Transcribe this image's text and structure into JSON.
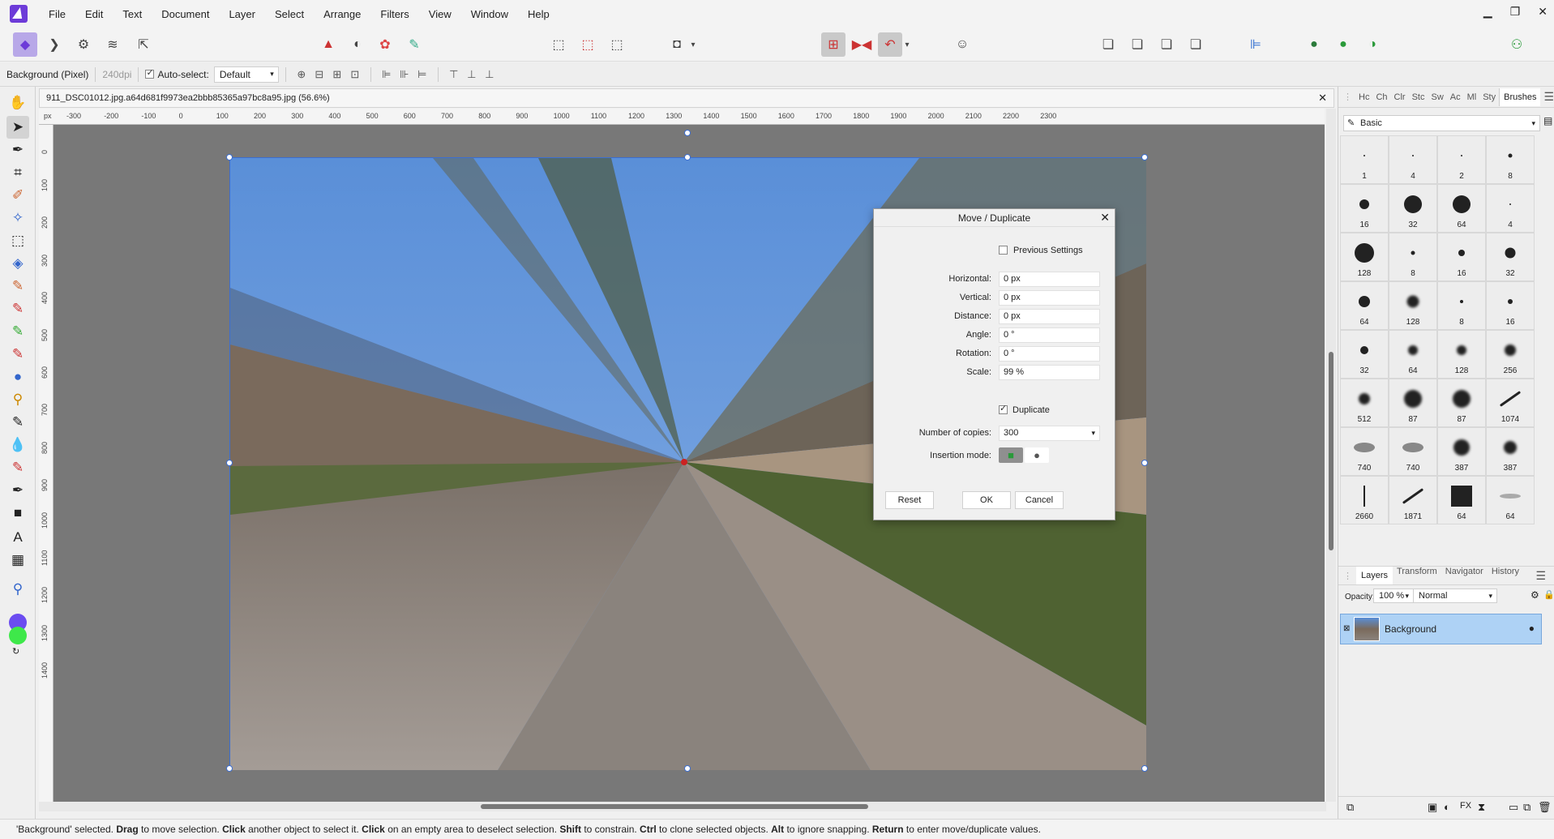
{
  "menu": [
    "File",
    "Edit",
    "Text",
    "Document",
    "Layer",
    "Select",
    "Arrange",
    "Filters",
    "View",
    "Window",
    "Help"
  ],
  "context": {
    "layer_name": "Background (Pixel)",
    "dpi": "240dpi",
    "auto_select_label": "Auto-select:",
    "auto_select_value": "Default"
  },
  "document": {
    "tab_title": "911_DSC01012.jpg.a64d681f9973ea2bbb85365a97bc8a95.jpg (56.6%)",
    "ruler_unit": "px",
    "hruler_ticks": [
      "-300",
      "-200",
      "-100",
      "0",
      "100",
      "200",
      "300",
      "400",
      "500",
      "600",
      "700",
      "800",
      "900",
      "1000",
      "1100",
      "1200",
      "1300",
      "1400",
      "1500",
      "1600",
      "1700",
      "1800",
      "1900",
      "2000",
      "2100",
      "2200",
      "2300"
    ],
    "vruler_ticks": [
      "0",
      "100",
      "200",
      "300",
      "400",
      "500",
      "600",
      "700",
      "800",
      "900",
      "1000",
      "1100",
      "1200",
      "1300",
      "1400"
    ]
  },
  "dialog": {
    "title": "Move / Duplicate",
    "previous_settings": "Previous Settings",
    "fields": [
      {
        "label": "Horizontal:",
        "value": "0 px"
      },
      {
        "label": "Vertical:",
        "value": "0 px"
      },
      {
        "label": "Distance:",
        "value": "0 px"
      },
      {
        "label": "Angle:",
        "value": "0 °"
      },
      {
        "label": "Rotation:",
        "value": "0 °"
      },
      {
        "label": "Scale:",
        "value": "99 %"
      }
    ],
    "duplicate_label": "Duplicate",
    "duplicate_checked": true,
    "copies_label": "Number of copies:",
    "copies_value": "300",
    "insertion_label": "Insertion mode:",
    "reset": "Reset",
    "ok": "OK",
    "cancel": "Cancel"
  },
  "brushes": {
    "tabs": [
      "Hc",
      "Ch",
      "Clr",
      "Stc",
      "Sw",
      "Ac",
      "Ml",
      "Sty"
    ],
    "active_tab": "Brushes",
    "category": "Basic",
    "items": [
      "1",
      "4",
      "2",
      "8",
      "16",
      "32",
      "64",
      "4",
      "128",
      "8",
      "16",
      "32",
      "64",
      "128",
      "8",
      "16",
      "32",
      "64",
      "128",
      "256",
      "512",
      "87",
      "87",
      "1074",
      "740",
      "740",
      "387",
      "387",
      "2660",
      "1871",
      "64",
      "64"
    ]
  },
  "layers": {
    "tabs": [
      "Layers",
      "Transform",
      "Navigator",
      "History"
    ],
    "opacity_label": "Opacity:",
    "opacity_value": "100 %",
    "blend_mode": "Normal",
    "layer_name": "Background"
  },
  "status": {
    "parts": [
      {
        "t": "'Background' selected. ",
        "b": false
      },
      {
        "t": "Drag",
        "b": true
      },
      {
        "t": " to move selection. ",
        "b": false
      },
      {
        "t": "Click",
        "b": true
      },
      {
        "t": " another object to select it. ",
        "b": false
      },
      {
        "t": "Click",
        "b": true
      },
      {
        "t": " on an empty area to deselect selection. ",
        "b": false
      },
      {
        "t": "Shift",
        "b": true
      },
      {
        "t": " to constrain. ",
        "b": false
      },
      {
        "t": "Ctrl",
        "b": true
      },
      {
        "t": " to clone selected objects. ",
        "b": false
      },
      {
        "t": "Alt",
        "b": true
      },
      {
        "t": " to ignore snapping. ",
        "b": false
      },
      {
        "t": "Return",
        "b": true
      },
      {
        "t": " to enter move/duplicate values.",
        "b": false
      }
    ]
  },
  "colors": {
    "accent": "#3c6ed0",
    "selection": "#aed2f5",
    "primary_color": "#6b4cf0",
    "secondary_color": "#3ee84a"
  }
}
